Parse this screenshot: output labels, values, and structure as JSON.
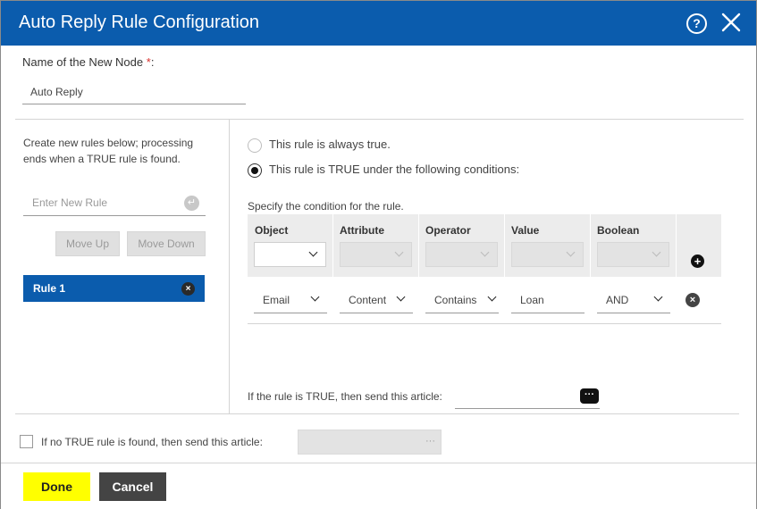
{
  "dialog": {
    "title": "Auto Reply Rule Configuration",
    "help_icon_glyph": "?",
    "close_icon": "close-x-icon"
  },
  "node": {
    "label": "Name of the New Node",
    "required_mark": "*",
    "label_suffix": ":",
    "value": "Auto Reply"
  },
  "rules_panel": {
    "help_text": "Create new rules below; processing ends when a TRUE rule is found.",
    "new_rule_placeholder": "Enter New Rule",
    "move_up_label": "Move Up",
    "move_down_label": "Move Down",
    "rules": [
      {
        "name": "Rule 1",
        "selected": true
      }
    ]
  },
  "conditions": {
    "always_true_label": "This rule is always true.",
    "conditional_label": "This rule is TRUE under the following conditions:",
    "selected_option": "conditional",
    "specify_label": "Specify the condition for the rule.",
    "columns": [
      "Object",
      "Attribute",
      "Operator",
      "Value",
      "Boolean"
    ],
    "rows": [
      {
        "object": "Email",
        "attribute": "Content",
        "operator": "Contains",
        "value": "Loan",
        "boolean": "AND"
      }
    ],
    "send_article_label": "If the rule is TRUE, then send this article:",
    "send_article_value": ""
  },
  "fallback": {
    "checked": false,
    "label": "If no TRUE rule is found, then send this article:",
    "dots": "···"
  },
  "footer": {
    "done_label": "Done",
    "cancel_label": "Cancel"
  },
  "colors": {
    "titlebar": "#0b5cad",
    "selected_rule": "#0b5cad",
    "done_button": "#ffff00",
    "cancel_button": "#444444",
    "required": "#d9302c"
  }
}
